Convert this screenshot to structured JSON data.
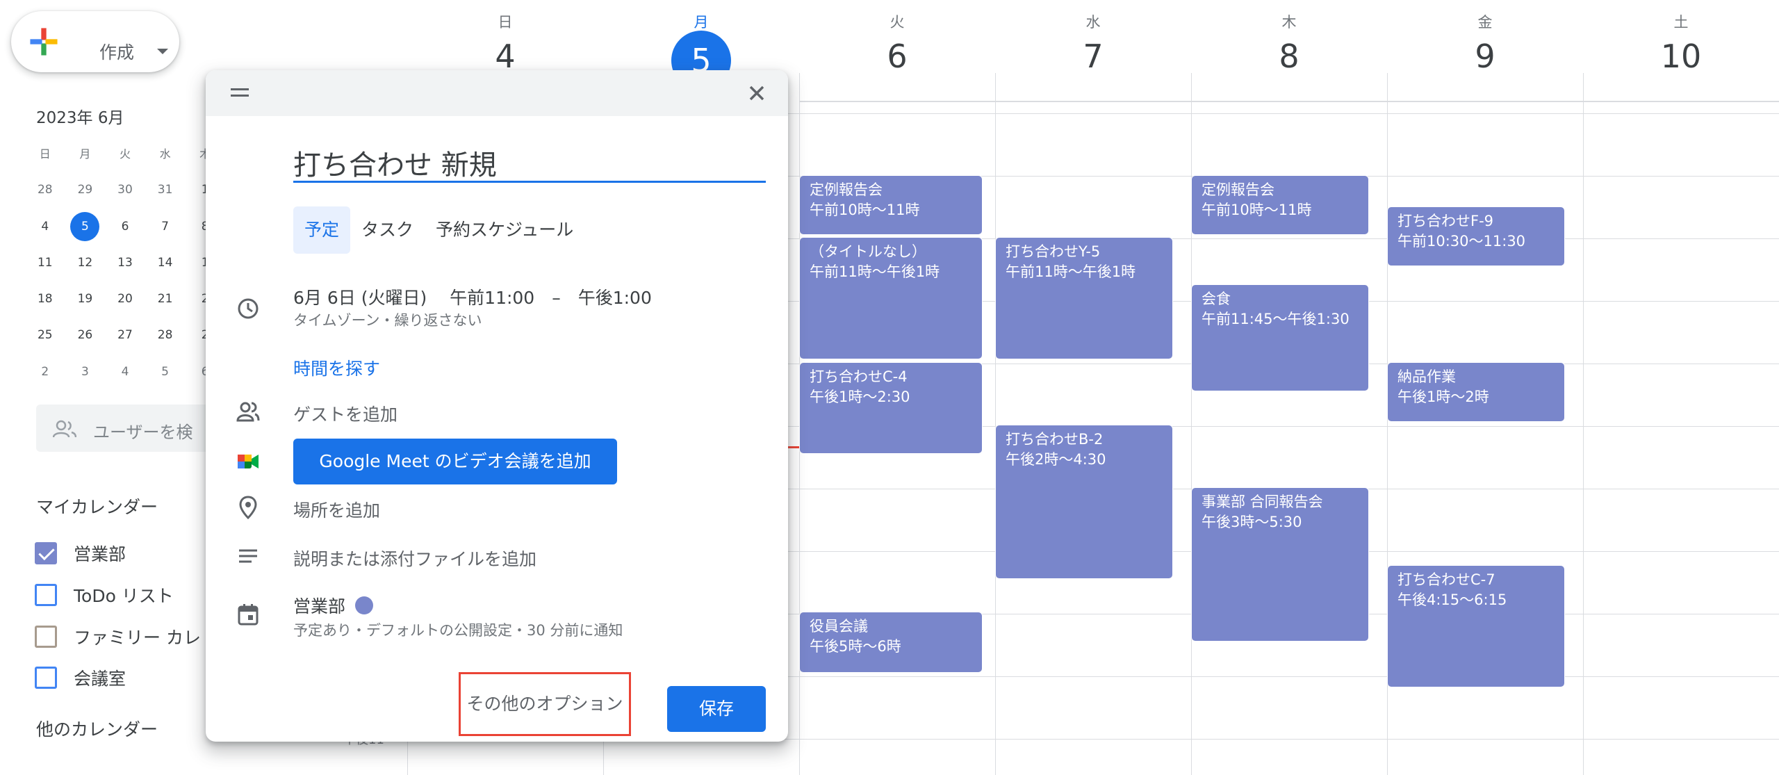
{
  "create": {
    "label": "作成"
  },
  "mini_calendar": {
    "title": "2023年 6月",
    "weekday_headers": [
      "日",
      "月",
      "火",
      "水",
      "木"
    ],
    "weeks": [
      [
        "28",
        "29",
        "30",
        "31",
        "1"
      ],
      [
        "4",
        "5",
        "6",
        "7",
        "8"
      ],
      [
        "11",
        "12",
        "13",
        "14",
        "1"
      ],
      [
        "18",
        "19",
        "20",
        "21",
        "2"
      ],
      [
        "25",
        "26",
        "27",
        "28",
        "2"
      ],
      [
        "2",
        "3",
        "4",
        "5",
        "6"
      ]
    ],
    "today": "5"
  },
  "user_search": {
    "placeholder": "ユーザーを検"
  },
  "my_calendars": {
    "title": "マイカレンダー",
    "items": [
      {
        "label": "営業部",
        "checked": true,
        "color": "#7986cb"
      },
      {
        "label": "ToDo リスト",
        "checked": false,
        "color": "#4285f4"
      },
      {
        "label": "ファミリー カレ",
        "checked": false,
        "color": "#a79b8e"
      },
      {
        "label": "会議室",
        "checked": false,
        "color": "#4285f4"
      }
    ]
  },
  "other_calendars": {
    "title": "他のカレンダー"
  },
  "week": {
    "days": [
      {
        "dow": "日",
        "num": "4"
      },
      {
        "dow": "月",
        "num": "5",
        "today": true
      },
      {
        "dow": "火",
        "num": "6"
      },
      {
        "dow": "水",
        "num": "7"
      },
      {
        "dow": "木",
        "num": "8"
      },
      {
        "dow": "金",
        "num": "9"
      },
      {
        "dow": "土",
        "num": "10"
      }
    ],
    "time_label": "午後11"
  },
  "events": [
    {
      "title": "定例報告会",
      "when": "午前10時〜11時",
      "day": "火"
    },
    {
      "title": "（タイトルなし）",
      "when": "午前11時〜午後1時",
      "day": "火"
    },
    {
      "title": "打ち合わせC-4",
      "when": "午後1時〜2:30",
      "day": "火"
    },
    {
      "title": "役員会議",
      "when": "午後5時〜6時",
      "day": "火"
    },
    {
      "title": "打ち合わせY-5",
      "when": "午前11時〜午後1時",
      "day": "水"
    },
    {
      "title": "打ち合わせB-2",
      "when": "午後2時〜4:30",
      "day": "水"
    },
    {
      "title": "定例報告会",
      "when": "午前10時〜11時",
      "day": "木"
    },
    {
      "title": "会食",
      "when": "午前11:45〜午後1:30",
      "day": "木"
    },
    {
      "title": "事業部 合同報告会",
      "when": "午後3時〜5:30",
      "day": "木"
    },
    {
      "title": "打ち合わせF-9",
      "when": "午前10:30〜11:30",
      "day": "金"
    },
    {
      "title": "納品作業",
      "when": "午後1時〜2時",
      "day": "金"
    },
    {
      "title": "打ち合わせC-7",
      "when": "午後4:15〜6:15",
      "day": "金"
    }
  ],
  "dialog": {
    "title_value": "打ち合わせ 新規",
    "tabs": [
      "予定",
      "タスク",
      "予約スケジュール"
    ],
    "active_tab": "予定",
    "datetime": "6月 6日 (火曜日)　 午前11:00　–　午後1:00",
    "datetime_sub": "タイムゾーン・繰り返さない",
    "find_time": "時間を探す",
    "add_guests": "ゲストを追加",
    "meet_button": "Google Meet のビデオ会議を追加",
    "add_location": "場所を追加",
    "add_description": "説明または添付ファイルを追加",
    "calendar_name": "営業部",
    "calendar_sub": "予定あり・デフォルトの公開設定・30 分前に通知",
    "more_options": "その他のオプション",
    "save": "保存"
  },
  "colors": {
    "accent": "#1a73e8",
    "event": "#7986cb",
    "highlight": "#ea4335"
  }
}
